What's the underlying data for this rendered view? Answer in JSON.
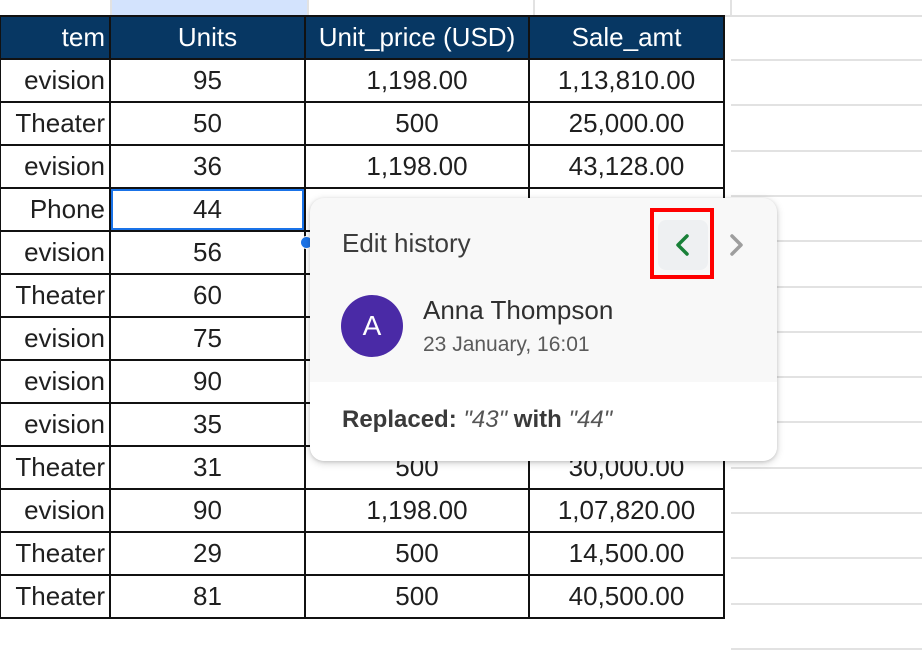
{
  "sheet": {
    "headers": [
      "tem",
      "Units",
      "Unit_price (USD)",
      "Sale_amt"
    ],
    "selected_cell": {
      "row": 3,
      "column": "Units",
      "value": "44"
    },
    "rows": [
      {
        "item": "evision",
        "units": "95",
        "price": "1,198.00",
        "sale": "1,13,810.00"
      },
      {
        "item": " Theater",
        "units": "50",
        "price": "500",
        "sale": "25,000.00"
      },
      {
        "item": "evision",
        "units": "36",
        "price": "1,198.00",
        "sale": "43,128.00"
      },
      {
        "item": " Phone",
        "units": "44",
        "price": "",
        "sale": ""
      },
      {
        "item": "evision",
        "units": "56",
        "price": "",
        "sale": ""
      },
      {
        "item": " Theater",
        "units": "60",
        "price": "",
        "sale": ""
      },
      {
        "item": "evision",
        "units": "75",
        "price": "",
        "sale": ""
      },
      {
        "item": "evision",
        "units": "90",
        "price": "",
        "sale": ""
      },
      {
        "item": "evision",
        "units": "35",
        "price": "",
        "sale": ""
      },
      {
        "item": " Theater",
        "units": "31",
        "price": "500",
        "sale": "30,000.00"
      },
      {
        "item": "evision",
        "units": "90",
        "price": "1,198.00",
        "sale": "1,07,820.00"
      },
      {
        "item": " Theater",
        "units": "29",
        "price": "500",
        "sale": "14,500.00"
      },
      {
        "item": " Theater",
        "units": "81",
        "price": "500",
        "sale": "40,500.00"
      }
    ]
  },
  "edit_history": {
    "title": "Edit history",
    "prev_icon": "chevron-left-icon",
    "next_icon": "chevron-right-icon",
    "user_initial": "A",
    "user_name": "Anna Thompson",
    "timestamp": "23 January, 16:01",
    "change_label": "Replaced:",
    "old_value": "\"43\"",
    "with_label": "with",
    "new_value": "\"44\""
  },
  "colors": {
    "header_bg": "#073763",
    "avatar_bg": "#4a2aa6",
    "prev_arrow": "#188038",
    "highlight": "#ff0000",
    "selection": "#1a73e8"
  }
}
